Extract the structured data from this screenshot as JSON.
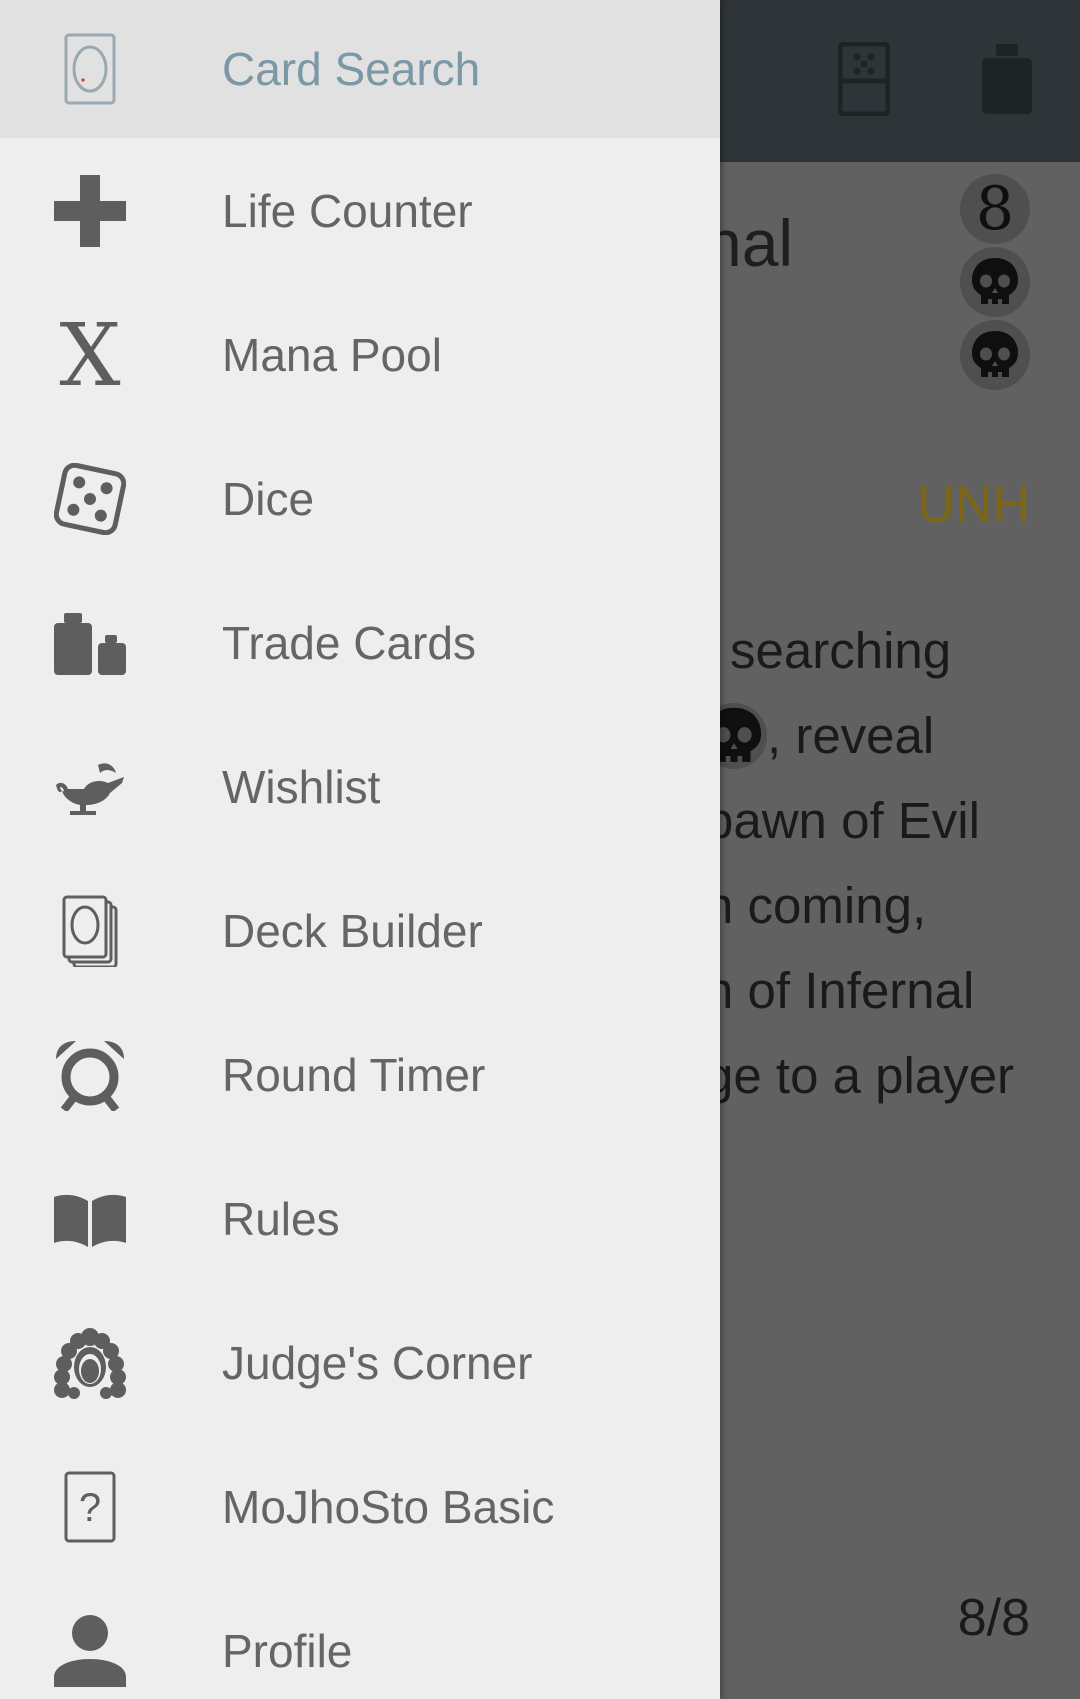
{
  "background": {
    "title_fragment": "nal",
    "mana_cost": [
      "8",
      "skull",
      "skull"
    ],
    "set_code": "UNH",
    "rules_lines": [
      "searching",
      ", reveal",
      "pawn of Evil",
      "n coming,",
      "n of Infernal",
      "ge to a player"
    ],
    "page_counter": "8/8",
    "toolbar_icons": [
      "dice-icon",
      "weight-icon"
    ]
  },
  "drawer": {
    "items": [
      {
        "label": "Card Search",
        "icon": "card-search-icon",
        "selected": true
      },
      {
        "label": "Life Counter",
        "icon": "plus-icon",
        "selected": false
      },
      {
        "label": "Mana Pool",
        "icon": "mana-x-icon",
        "selected": false
      },
      {
        "label": "Dice",
        "icon": "dice-icon",
        "selected": false
      },
      {
        "label": "Trade Cards",
        "icon": "trade-weights-icon",
        "selected": false
      },
      {
        "label": "Wishlist",
        "icon": "genie-lamp-icon",
        "selected": false
      },
      {
        "label": "Deck Builder",
        "icon": "card-stack-icon",
        "selected": false
      },
      {
        "label": "Round Timer",
        "icon": "alarm-clock-icon",
        "selected": false
      },
      {
        "label": "Rules",
        "icon": "open-book-icon",
        "selected": false
      },
      {
        "label": "Judge's Corner",
        "icon": "judge-wig-icon",
        "selected": false
      },
      {
        "label": "MoJhoSto Basic",
        "icon": "question-card-icon",
        "selected": false
      },
      {
        "label": "Profile",
        "icon": "person-icon",
        "selected": false
      }
    ]
  },
  "colors": {
    "selected_label": "#7b98a6",
    "label": "#656565",
    "drawer_bg": "#eeeeee",
    "selected_bg": "#e1e1e1",
    "toolbar_bg": "#2e3438",
    "set_code": "#7d6714"
  }
}
